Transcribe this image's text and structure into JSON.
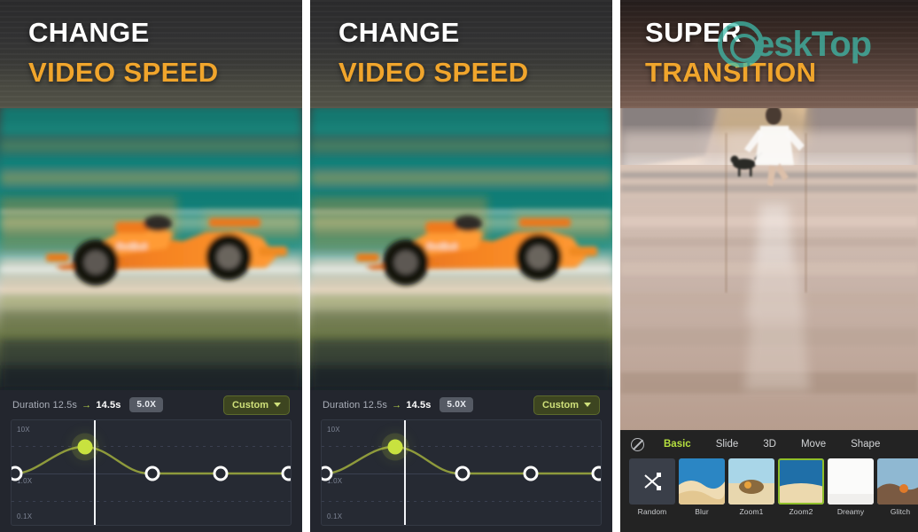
{
  "panels": [
    {
      "id": "panel-change-video-speed-1",
      "title_line1": "CHANGE",
      "title_line2": "VIDEO SPEED",
      "artwork": "f1-race-car-motion-blur",
      "editor": {
        "duration_prefix": "Duration",
        "duration_from": "12.5s",
        "arrow": "→",
        "duration_to": "14.5s",
        "speed_badge": "5.0X",
        "preset_label": "Custom",
        "axis_top": "10X",
        "axis_mid": "1.0X",
        "axis_bottom": "0.1X"
      }
    },
    {
      "id": "panel-change-video-speed-2",
      "title_line1": "CHANGE",
      "title_line2": "VIDEO SPEED",
      "artwork": "f1-race-car-motion-blur",
      "editor": {
        "duration_prefix": "Duration",
        "duration_from": "12.5s",
        "arrow": "→",
        "duration_to": "14.5s",
        "speed_badge": "5.0X",
        "preset_label": "Custom",
        "axis_top": "10X",
        "axis_mid": "1.0X",
        "axis_bottom": "0.1X"
      }
    },
    {
      "id": "panel-super-transition",
      "title_line1": "SUPER",
      "title_line2": "TRANSITION",
      "artwork": "beach-woman-dog-double-exposure",
      "transitions": {
        "none_icon": "no-transition-icon",
        "tabs": [
          {
            "label": "Basic",
            "active": true
          },
          {
            "label": "Slide",
            "active": false
          },
          {
            "label": "3D",
            "active": false
          },
          {
            "label": "Move",
            "active": false
          },
          {
            "label": "Shape",
            "active": false
          }
        ],
        "items": [
          {
            "label": "Random",
            "selected": false,
            "icon": "shuffle-icon"
          },
          {
            "label": "Blur",
            "selected": false
          },
          {
            "label": "Zoom1",
            "selected": false
          },
          {
            "label": "Zoom2",
            "selected": true
          },
          {
            "label": "Dreamy",
            "selected": false
          },
          {
            "label": "Glitch",
            "selected": false
          }
        ]
      }
    }
  ],
  "watermark": {
    "text": "eskTop",
    "color": "#3fbfae"
  },
  "colors": {
    "accent_orange": "#f0a52c",
    "accent_green": "#b6e03f",
    "handle_green": "#c8e23f",
    "editor_bg": "#23262e",
    "picker_bg": "#232323"
  }
}
